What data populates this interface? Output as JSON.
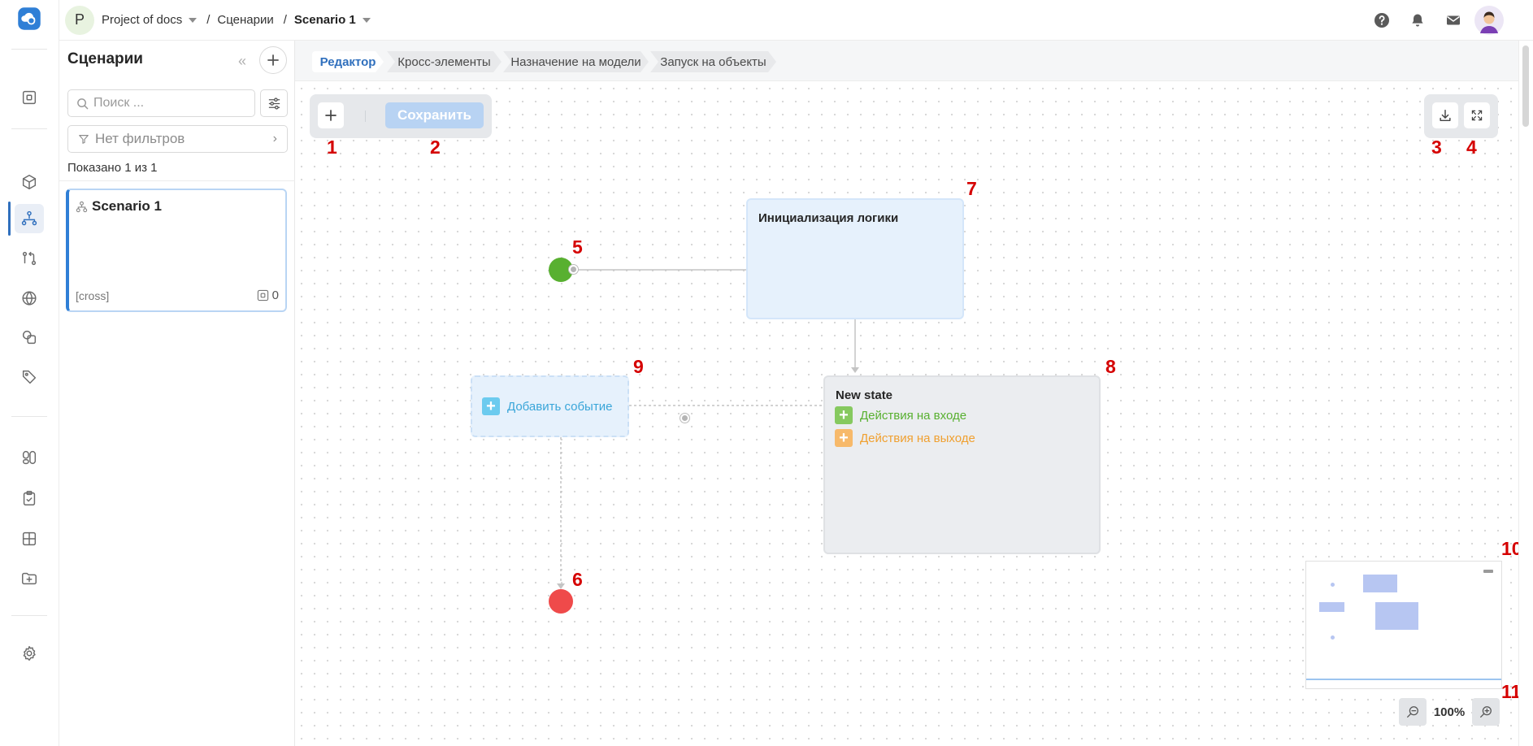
{
  "topbar": {
    "project_avatar_letter": "P",
    "project_name": "Project of docs",
    "section": "Сценарии",
    "current": "Scenario 1"
  },
  "panel": {
    "title": "Сценарии",
    "collapse_glyph": "«",
    "search_placeholder": "Поиск ...",
    "filter_label": "Нет фильтров",
    "shown_count": "Показано 1 из 1",
    "scenario": {
      "name": "Scenario 1",
      "tag": "[cross]",
      "count": "0"
    }
  },
  "tabs": [
    {
      "label": "Редактор",
      "active": true
    },
    {
      "label": "Кросс-элементы",
      "active": false
    },
    {
      "label": "Назначение на модели",
      "active": false
    },
    {
      "label": "Запуск на объекты",
      "active": false
    }
  ],
  "toolbar": {
    "save_label": "Сохранить"
  },
  "nodes": {
    "init_state_title": "Инициализация логики",
    "new_state_title": "New state",
    "entry_actions": "Действия на входе",
    "exit_actions": "Действия на выходе",
    "add_event": "Добавить событие"
  },
  "zoom": {
    "value": "100%"
  },
  "markers": [
    "1",
    "2",
    "3",
    "4",
    "5",
    "6",
    "7",
    "8",
    "9",
    "10",
    "11"
  ],
  "colors": {
    "accent": "#2f6fbd",
    "start_node": "#58b030",
    "end_node": "#ef4a4a",
    "entry_action": "#6fbf4a",
    "exit_action": "#f5a623",
    "event": "#3aa6d9",
    "marker": "#d50000"
  },
  "icons": {
    "logo": "cloud-logo-icon",
    "help": "help-icon",
    "bell": "bell-icon",
    "mail": "mail-icon"
  }
}
